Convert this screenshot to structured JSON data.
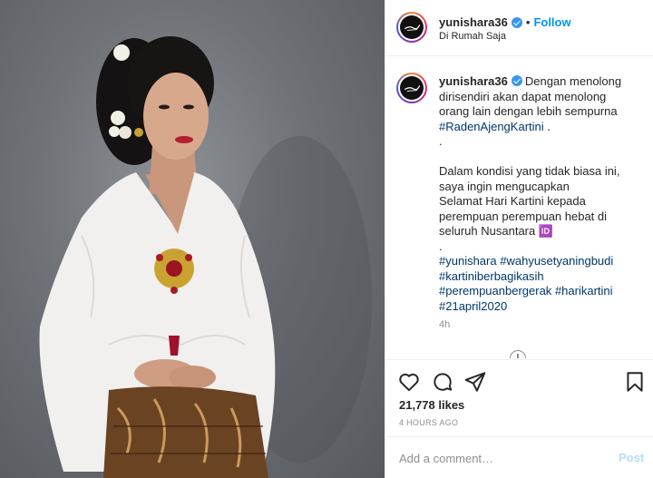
{
  "post": {
    "username": "yunishara36",
    "follow_label": "Follow",
    "separator": "•",
    "location": "Di Rumah Saja",
    "photo_alt": "Photo by yunishara36"
  },
  "caption": {
    "username": "yunishara36",
    "lines": [
      "Dengan menolong",
      "dirisendiri akan dapat menolong",
      "orang lain dengan lebih sempurna",
      "#RadenAjengKartini .",
      ".",
      "",
      "Dalam kondisi yang tidak biasa ini,",
      "saya ingin mengucapkan",
      "Selamat Hari Kartini kepada",
      "perempuan perempuan hebat di",
      "seluruh Nusantara 🆔",
      ".",
      "#yunishara #wahyusetyaningbudi",
      "#kartiniberbagikasih",
      "#perempuanbergerak #harikartini",
      "#21april2020"
    ],
    "hashtags": {
      "t1": "#RadenAjengKartini",
      "t1_suffix": " .",
      "t2": "#yunishara",
      "t3": "#wahyusetyaningbudi",
      "t4": "#kartiniberbagikasih",
      "t5": "#perempuanbergerak",
      "t6": "#harikartini",
      "t7": "#21april2020"
    },
    "time_ago": "4h"
  },
  "actions": {
    "icons": [
      "heart-icon",
      "comment-icon",
      "share-icon",
      "bookmark-icon"
    ],
    "likes": "21,778 likes",
    "posted": "4 HOURS AGO"
  },
  "comment": {
    "placeholder": "Add a comment…",
    "post_label": "Post"
  },
  "colors": {
    "link": "#0095f6",
    "hashtag": "#00376b",
    "muted": "#8e8e8e",
    "verified": "#3897f0",
    "post_disabled": "#b2dffc"
  }
}
